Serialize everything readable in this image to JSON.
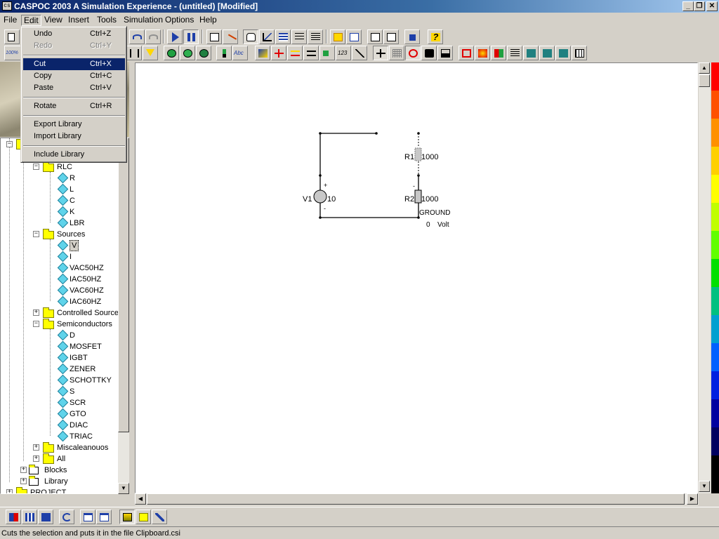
{
  "window": {
    "app_icon": "cs",
    "title": "CASPOC 2003 A Simulation Experience - (untitled) [Modified]",
    "controls": [
      "_",
      "❐",
      "✕"
    ]
  },
  "menubar": {
    "items": [
      {
        "label": "File"
      },
      {
        "label": "Edit"
      },
      {
        "label": "View"
      },
      {
        "label": "Insert"
      },
      {
        "label": "Tools"
      },
      {
        "label": "Simulation"
      },
      {
        "label": "Options"
      },
      {
        "label": "Help"
      }
    ]
  },
  "toolbar": {
    "zoom_label": "100%",
    "text_tool_label": "Abc",
    "number_tool_label": "123",
    "help_glyph": "?"
  },
  "edit_menu": {
    "items": [
      {
        "label": "Undo",
        "shortcut": "Ctrl+Z",
        "enabled": true
      },
      {
        "label": "Redo",
        "shortcut": "Ctrl+Y",
        "enabled": false
      },
      {
        "label": "Cut",
        "shortcut": "Ctrl+X",
        "enabled": true,
        "highlighted": true
      },
      {
        "label": "Copy",
        "shortcut": "Ctrl+C",
        "enabled": true
      },
      {
        "label": "Paste",
        "shortcut": "Ctrl+V",
        "enabled": true
      },
      {
        "label": "Rotate",
        "shortcut": "Ctrl+R",
        "enabled": true
      },
      {
        "label": "Export Library",
        "shortcut": "",
        "enabled": true
      },
      {
        "label": "Import Library",
        "shortcut": "",
        "enabled": true
      },
      {
        "label": "Include Library",
        "shortcut": "",
        "enabled": true
      }
    ]
  },
  "tree": {
    "nodes": [
      {
        "label": "RLC",
        "type": "folder",
        "expanded": true
      },
      {
        "label": "R",
        "type": "component"
      },
      {
        "label": "L",
        "type": "component"
      },
      {
        "label": "C",
        "type": "component"
      },
      {
        "label": "K",
        "type": "component"
      },
      {
        "label": "LBR",
        "type": "component"
      },
      {
        "label": "Sources",
        "type": "folder",
        "expanded": true
      },
      {
        "label": "V",
        "type": "component",
        "selected": true
      },
      {
        "label": "I",
        "type": "component"
      },
      {
        "label": "VAC50HZ",
        "type": "component"
      },
      {
        "label": "IAC50HZ",
        "type": "component"
      },
      {
        "label": "VAC60HZ",
        "type": "component"
      },
      {
        "label": "IAC60HZ",
        "type": "component"
      },
      {
        "label": "Controlled Source",
        "type": "folder",
        "expanded": false
      },
      {
        "label": "Semiconductors",
        "type": "folder",
        "expanded": true
      },
      {
        "label": "D",
        "type": "component"
      },
      {
        "label": "MOSFET",
        "type": "component"
      },
      {
        "label": "IGBT",
        "type": "component"
      },
      {
        "label": "ZENER",
        "type": "component"
      },
      {
        "label": "SCHOTTKY",
        "type": "component"
      },
      {
        "label": "S",
        "type": "component"
      },
      {
        "label": "SCR",
        "type": "component"
      },
      {
        "label": "GTO",
        "type": "component"
      },
      {
        "label": "DIAC",
        "type": "component"
      },
      {
        "label": "TRIAC",
        "type": "component"
      },
      {
        "label": "Miscaleanouos",
        "type": "folder",
        "expanded": false
      },
      {
        "label": "All",
        "type": "folder",
        "expanded": false
      },
      {
        "label": "Blocks",
        "type": "block",
        "expanded": false
      },
      {
        "label": "Library",
        "type": "block",
        "expanded": false
      },
      {
        "label": "PROJECT",
        "type": "folder",
        "expanded": false
      }
    ]
  },
  "schematic": {
    "v1": {
      "name": "V1",
      "value": "10",
      "plus": "+",
      "minus": "-"
    },
    "r1": {
      "name": "R1",
      "value": "1000"
    },
    "r2": {
      "name": "R2",
      "value": "1000",
      "mark": "-"
    },
    "ground": {
      "label": "GROUND",
      "value": "0",
      "unit": "Volt"
    }
  },
  "status": {
    "text": "Cuts the selection and puts it in the file Clipboard.csi"
  },
  "colors": {
    "titlebar_start": "#0a246a",
    "menu_highlight": "#0a246a",
    "folder": "#ffff00",
    "component": "#5fd3ea"
  }
}
